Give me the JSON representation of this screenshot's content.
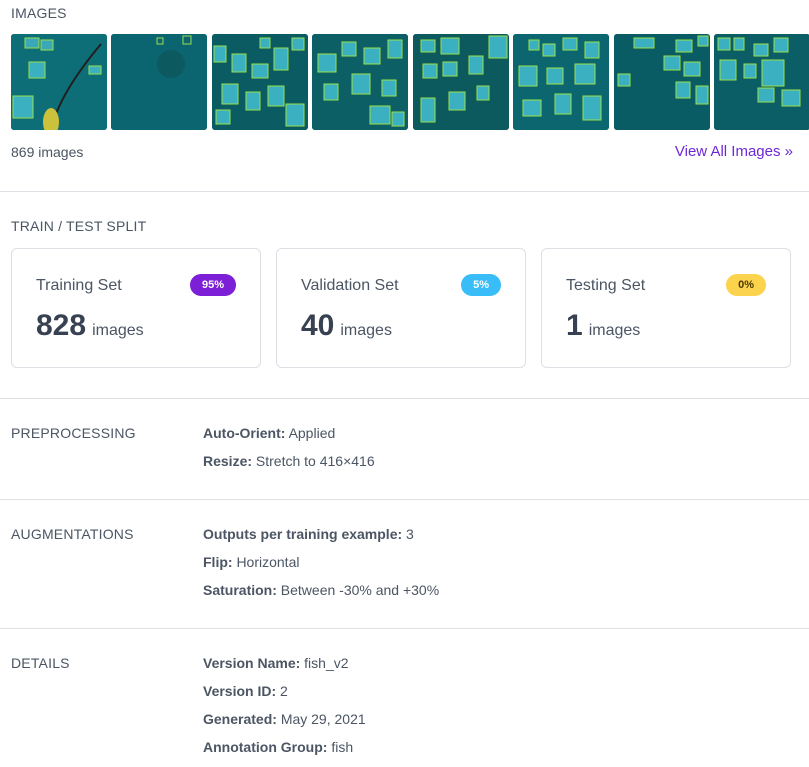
{
  "images": {
    "section_label": "IMAGES",
    "count_label": "869 images",
    "view_all_label": "View All Images »",
    "accent_color": "#6d28d9"
  },
  "split": {
    "section_label": "TRAIN / TEST SPLIT",
    "cards": [
      {
        "title": "Training Set",
        "badge": "95%",
        "badge_bg": "#7c1fd6",
        "badge_fg": "#ffffff",
        "count": "828",
        "unit": "images"
      },
      {
        "title": "Validation Set",
        "badge": "5%",
        "badge_bg": "#38bdf8",
        "badge_fg": "#ffffff",
        "count": "40",
        "unit": "images"
      },
      {
        "title": "Testing Set",
        "badge": "0%",
        "badge_bg": "#fcd34d",
        "badge_fg": "#4b3a00",
        "count": "1",
        "unit": "images"
      }
    ]
  },
  "preprocessing": {
    "section_label": "PREPROCESSING",
    "items": [
      {
        "key": "Auto-Orient:",
        "value": "Applied"
      },
      {
        "key": "Resize:",
        "value": "Stretch to 416×416"
      }
    ]
  },
  "augmentations": {
    "section_label": "AUGMENTATIONS",
    "items": [
      {
        "key": "Outputs per training example:",
        "value": "3"
      },
      {
        "key": "Flip:",
        "value": "Horizontal"
      },
      {
        "key": "Saturation:",
        "value": "Between -30% and +30%"
      }
    ]
  },
  "details": {
    "section_label": "DETAILS",
    "items": [
      {
        "key": "Version Name:",
        "value": "fish_v2"
      },
      {
        "key": "Version ID:",
        "value": "2"
      },
      {
        "key": "Generated:",
        "value": "May 29, 2021"
      },
      {
        "key": "Annotation Group:",
        "value": "fish"
      }
    ]
  }
}
